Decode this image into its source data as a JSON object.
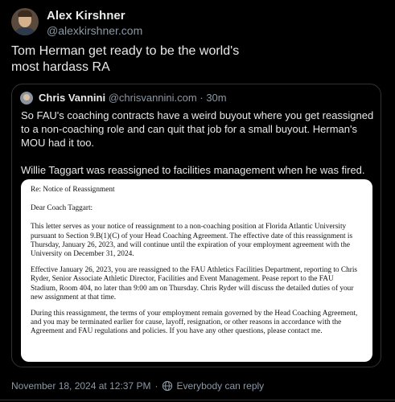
{
  "author": {
    "display_name": "Alex Kirshner",
    "handle": "@alexkirshner.com"
  },
  "post": {
    "text": "Tom Herman get ready to be the world's\nmost hardass RA"
  },
  "quote": {
    "display_name": "Chris Vannini",
    "handle": "@chrisvannini.com",
    "separator": "·",
    "age": "30m",
    "paragraphs": [
      "So FAU's coaching contracts have a weird buyout where you get reassigned to a non-coaching role and can quit that job for a small buyout. Herman's MOU had it too.",
      "Willie Taggart was reassigned to facilities management when he was fired."
    ],
    "letter": {
      "re": "Re: Notice of Reassignment",
      "salutation": "Dear Coach Taggart:",
      "paragraphs": [
        "This letter serves as your notice of reassignment to a non-coaching position at Florida Atlantic University pursuant to Section 9.B(1)(C) of your Head Coaching Agreement. The effective date of this reassignment is Thursday, January 26, 2023, and will continue until the expiration of your employment agreement with the University on December 31, 2024.",
        "Effective January 26, 2023, you are reassigned to the FAU Athletics Facilities Department, reporting to Chris Ryder, Senior Associate Athletic Director, Facilities and Event Management. Pease report to the FAU Stadium, Room 404, no later than 9:00 am on Thursday. Chris Ryder will discuss the detailed duties of your new assignment at that time.",
        "During this reassignment, the terms of your employment remain governed by the Head Coaching Agreement, and you may be terminated earlier for cause, layoff, resignation, or other reasons in accordance with the Agreement and FAU regulations and policies. If you have any other questions, please contact me."
      ]
    }
  },
  "footer": {
    "timestamp": "November 18, 2024 at 12:37 PM",
    "separator": "·",
    "reply_setting": "Everybody can reply"
  },
  "icons": {
    "reply_setting": "globe-icon"
  },
  "colors": {
    "background": "#000000",
    "primary_text": "#e7e9ea",
    "secondary_text": "#8b98a5",
    "border": "#2f3336"
  }
}
